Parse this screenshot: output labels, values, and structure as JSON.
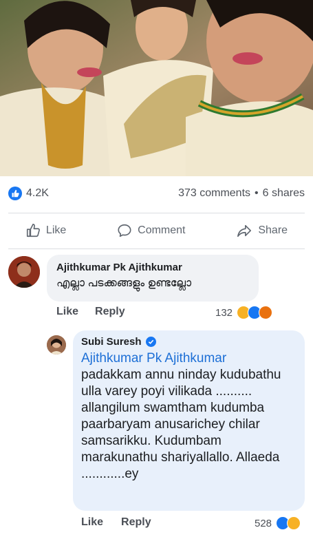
{
  "post": {
    "likes_count": "4.2K",
    "comments_count": "373 comments",
    "separator": "•",
    "shares_count": "6 shares"
  },
  "actions": {
    "like": "Like",
    "comment": "Comment",
    "share": "Share"
  },
  "comments": [
    {
      "author": "Ajithkumar Pk Ajithkumar",
      "text": "എല്ലാ പടക്കങ്ങളും ഉണ്ടല്ലോ",
      "like_label": "Like",
      "reply_label": "Reply",
      "reactions_count": "132"
    },
    {
      "author": "Subi Suresh",
      "mention": "Ajithkumar Pk Ajithkumar",
      "text": "padakkam annu ninday kudubathu ulla varey poyi vilikada .......... allangilum swamtham kudumba paarbaryam anusarichey chilar samsarikku. Kudumbam marakunathu shariyallallo. Allaeda ............ey",
      "like_label": "Like",
      "reply_label": "Reply",
      "reactions_count": "528"
    }
  ],
  "colors": {
    "facebook_blue": "#1877f2",
    "bubble_bg": "#f0f2f5",
    "reply_bubble_bg": "#e8f0fb",
    "meta_gray": "#4b4f56",
    "haha_yellow": "#f7b125",
    "angry_red": "#e9710f"
  }
}
